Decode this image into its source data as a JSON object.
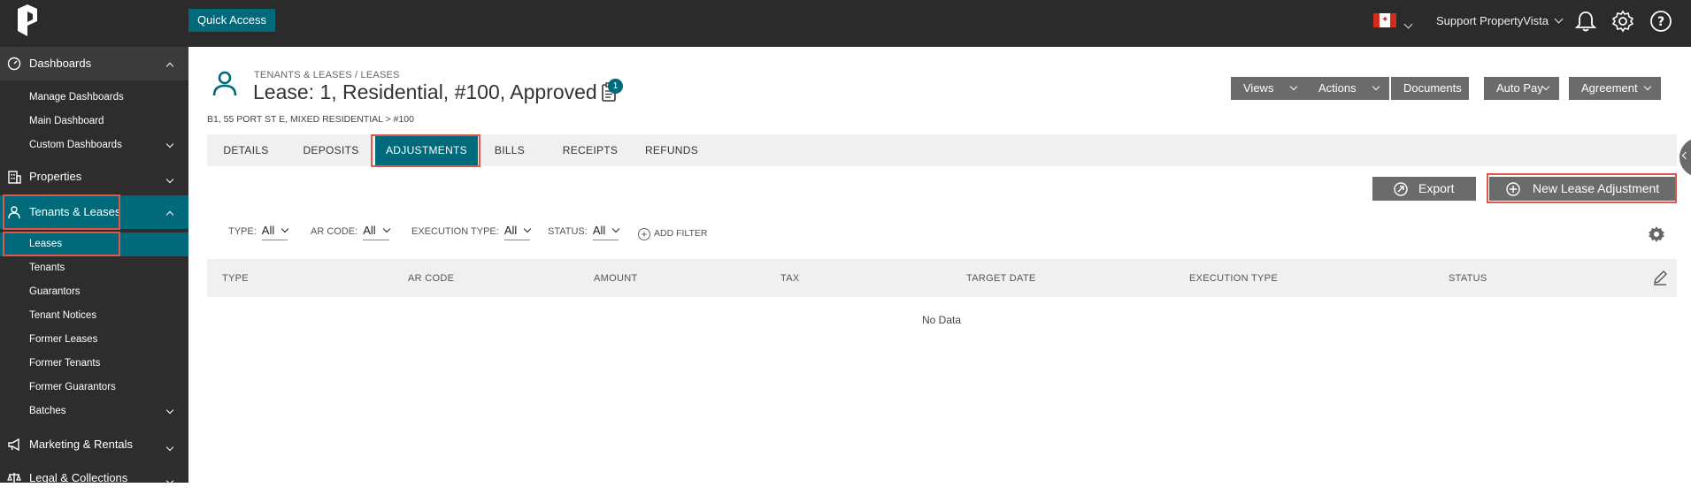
{
  "topbar": {
    "quick_access": "Quick Access",
    "user_name": "Support PropertyVista",
    "accent": "#00697a"
  },
  "sidebar": {
    "groups": [
      {
        "label": "Dashboards",
        "icon": "gauge-icon"
      },
      {
        "label": "Properties",
        "icon": "building-icon"
      },
      {
        "label": "Tenants & Leases",
        "icon": "person-icon"
      },
      {
        "label": "Marketing & Rentals",
        "icon": "megaphone-icon"
      },
      {
        "label": "Legal & Collections",
        "icon": "scales-icon"
      }
    ],
    "dashboards_items": [
      "Manage Dashboards",
      "Main Dashboard",
      "Custom Dashboards"
    ],
    "tenants_items": [
      "Leases",
      "Tenants",
      "Guarantors",
      "Tenant Notices",
      "Former Leases",
      "Former Tenants",
      "Former Guarantors",
      "Batches"
    ]
  },
  "header": {
    "breadcrumb": "TENANTS & LEASES  /  LEASES",
    "title": "Lease: 1, Residential, #100, Approved",
    "notes_count": "1",
    "subpath": "B1, 55 PORT ST E, MIXED RESIDENTIAL > #100",
    "toolbar": {
      "views": "Views",
      "actions": "Actions",
      "documents": "Documents",
      "autopay": "Auto Pay",
      "agreement": "Agreement"
    }
  },
  "tabs": [
    "DETAILS",
    "DEPOSITS",
    "ADJUSTMENTS",
    "BILLS",
    "RECEIPTS",
    "REFUNDS"
  ],
  "active_tab": "ADJUSTMENTS",
  "actions": {
    "export": "Export",
    "new_adjustment": "New Lease Adjustment"
  },
  "filters": [
    {
      "label": "TYPE:",
      "value": "All"
    },
    {
      "label": "AR CODE:",
      "value": "All"
    },
    {
      "label": "EXECUTION TYPE:",
      "value": "All"
    },
    {
      "label": "STATUS:",
      "value": "All"
    }
  ],
  "add_filter": "ADD FILTER",
  "table": {
    "columns": [
      "TYPE",
      "AR CODE",
      "AMOUNT",
      "TAX",
      "TARGET DATE",
      "EXECUTION TYPE",
      "STATUS"
    ],
    "empty_text": "No Data"
  }
}
